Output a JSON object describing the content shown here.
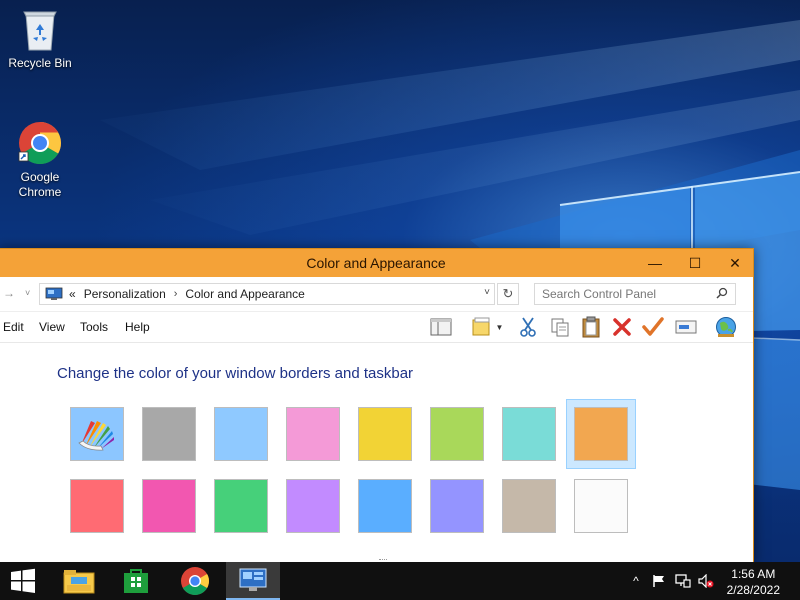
{
  "desktop": {
    "icons": [
      {
        "label": "Recycle Bin"
      },
      {
        "label": "Google Chrome"
      }
    ]
  },
  "window": {
    "title": "Color and Appearance",
    "controls": {
      "minimize": "—",
      "maximize": "☐",
      "close": "✕"
    },
    "address": {
      "prefix": "«",
      "breadcrumbs": [
        "Personalization",
        "Color and Appearance"
      ],
      "separator": "›"
    },
    "search": {
      "placeholder": "Search Control Panel"
    },
    "menu": [
      "Edit",
      "View",
      "Tools",
      "Help"
    ],
    "heading": "Change the color of your window borders and taskbar",
    "swatches": [
      {
        "name": "custom-color-mixer",
        "color": "#8cc6ff",
        "row": 0,
        "col": 0,
        "selected": false
      },
      {
        "name": "gray",
        "color": "#a8a8a8",
        "row": 0,
        "col": 1,
        "selected": false
      },
      {
        "name": "light-blue",
        "color": "#8fc9ff",
        "row": 0,
        "col": 2,
        "selected": false
      },
      {
        "name": "pink",
        "color": "#f49ad7",
        "row": 0,
        "col": 3,
        "selected": false
      },
      {
        "name": "yellow",
        "color": "#f2d335",
        "row": 0,
        "col": 4,
        "selected": false
      },
      {
        "name": "lime-green",
        "color": "#a9d85a",
        "row": 0,
        "col": 5,
        "selected": false
      },
      {
        "name": "teal",
        "color": "#7adcd7",
        "row": 0,
        "col": 6,
        "selected": false
      },
      {
        "name": "orange",
        "color": "#f2a750",
        "row": 0,
        "col": 7,
        "selected": true
      },
      {
        "name": "red",
        "color": "#ff6b73",
        "row": 1,
        "col": 0,
        "selected": false
      },
      {
        "name": "magenta",
        "color": "#f257b0",
        "row": 1,
        "col": 1,
        "selected": false
      },
      {
        "name": "green",
        "color": "#46d07a",
        "row": 1,
        "col": 2,
        "selected": false
      },
      {
        "name": "violet",
        "color": "#c28bff",
        "row": 1,
        "col": 3,
        "selected": false
      },
      {
        "name": "blue",
        "color": "#5aaeff",
        "row": 1,
        "col": 4,
        "selected": false
      },
      {
        "name": "periwinkle",
        "color": "#9494ff",
        "row": 1,
        "col": 5,
        "selected": false
      },
      {
        "name": "taupe",
        "color": "#c5b8a9",
        "row": 1,
        "col": 6,
        "selected": false
      },
      {
        "name": "white",
        "color": "#fbfbfb",
        "row": 1,
        "col": 7,
        "selected": false
      }
    ]
  },
  "taskbar": {
    "clock": {
      "time": "1:56 AM",
      "date": "2/28/2022"
    }
  },
  "colors": {
    "accent": "#f4a238",
    "heading": "#1e3287",
    "taskbar": "#101010"
  }
}
